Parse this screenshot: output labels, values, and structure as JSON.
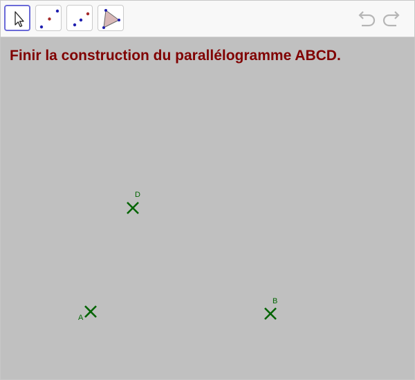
{
  "toolbar": {
    "tools": [
      {
        "name": "move-tool",
        "selected": true
      },
      {
        "name": "point-tool",
        "selected": false
      },
      {
        "name": "line-tool",
        "selected": false
      },
      {
        "name": "polygon-tool",
        "selected": false
      }
    ],
    "undo_icon": "undo-arrow-icon",
    "redo_icon": "redo-arrow-icon"
  },
  "canvas": {
    "instruction": "Finir la construction du parallélogramme ABCD.",
    "points": [
      {
        "label": "A"
      },
      {
        "label": "B"
      },
      {
        "label": "D"
      }
    ]
  },
  "colors": {
    "instruction_text": "#800000",
    "point": "#006400",
    "canvas_background": "#c0c0c0",
    "selected_tool_border": "#6a6ad8",
    "tool_dot_blue": "#1f1fb0",
    "tool_dot_red": "#a52a2a"
  }
}
